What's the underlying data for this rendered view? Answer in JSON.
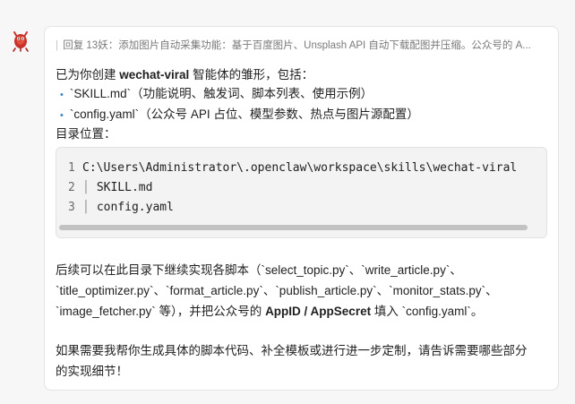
{
  "quote": {
    "bar": "|",
    "text": "回复 13妖：添加图片自动采集功能：基于百度图片、Unsplash API 自动下载配图并压缩。公众号的 A..."
  },
  "intro": {
    "prefix": "已为你创建 ",
    "name": "wechat-viral",
    "suffix": " 智能体的雏形，包括："
  },
  "bullets": [
    {
      "marker": "•",
      "text": "`SKILL.md`（功能说明、触发词、脚本列表、使用示例）"
    },
    {
      "marker": "•",
      "text": "`config.yaml`（公众号 API 占位、模型参数、热点与图片源配置）"
    }
  ],
  "dir_label": "目录位置：",
  "code": {
    "lines": [
      {
        "num": "1",
        "pipe": "",
        "text": "C:\\Users\\Administrator\\.openclaw\\workspace\\skills\\wechat-viral"
      },
      {
        "num": "2",
        "pipe": "│",
        "text": "SKILL.md"
      },
      {
        "num": "3",
        "pipe": "│",
        "text": "config.yaml"
      }
    ]
  },
  "para1": {
    "line1": "后续可以在此目录下继续实现各脚本（`select_topic.py`、`write_article.py`、",
    "line2": "`title_optimizer.py`、`format_article.py`、`publish_article.py`、`monitor_stats.py`、",
    "line3_prefix": "`image_fetcher.py` 等），并把公众号的 ",
    "line3_bold": "AppID / AppSecret",
    "line3_suffix": " 填入 `config.yaml`。"
  },
  "para2": {
    "line1": "如果需要我帮你生成具体的脚本代码、补全模板或进行进一步定制，请告诉需要哪些部分",
    "line2": "的实现细节！"
  },
  "colors": {
    "avatar_red": "#c8322a",
    "bullet_blue": "#3b82c4",
    "code_bg": "#f3f3f4"
  },
  "icons": {
    "avatar": "red-lobster-avatar-icon"
  }
}
